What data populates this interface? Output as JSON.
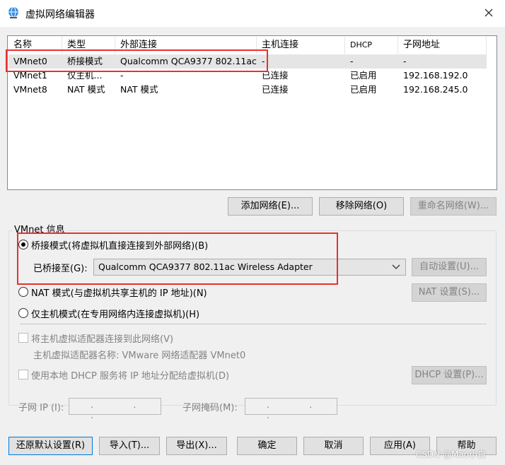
{
  "window": {
    "title": "虚拟网络编辑器",
    "icon": "globe-network-icon",
    "close": "close-icon"
  },
  "table": {
    "headers": [
      "名称",
      "类型",
      "外部连接",
      "主机连接",
      "DHCP",
      "子网地址"
    ],
    "rows": [
      {
        "name": "VMnet0",
        "type": "桥接模式",
        "external": "Qualcomm QCA9377 802.11ac...",
        "host": "-",
        "dhcp": "-",
        "subnet": "-"
      },
      {
        "name": "VMnet1",
        "type": "仅主机...",
        "external": "-",
        "host": "已连接",
        "dhcp": "已启用",
        "subnet": "192.168.192.0"
      },
      {
        "name": "VMnet8",
        "type": "NAT 模式",
        "external": "NAT 模式",
        "host": "已连接",
        "dhcp": "已启用",
        "subnet": "192.168.245.0"
      }
    ]
  },
  "table_buttons": {
    "add": "添加网络(E)...",
    "remove": "移除网络(O)",
    "rename": "重命名网络(W)..."
  },
  "vmnet_info": {
    "legend": "VMnet 信息",
    "bridged_label": "桥接模式(将虚拟机直接连接到外部网络)(B)",
    "bridged_to_label": "已桥接至(G):",
    "bridged_to_value": "Qualcomm QCA9377 802.11ac Wireless Adapter",
    "auto_settings": "自动设置(U)...",
    "nat_label": "NAT 模式(与虚拟机共享主机的 IP 地址)(N)",
    "nat_settings": "NAT 设置(S)...",
    "hostonly_label": "仅主机模式(在专用网络内连接虚拟机)(H)",
    "connect_adapter_label": "将主机虚拟适配器连接到此网络(V)",
    "adapter_name_label": "主机虚拟适配器名称: VMware 网络适配器 VMnet0",
    "dhcp_label": "使用本地 DHCP 服务将 IP 地址分配给虚拟机(D)",
    "dhcp_settings": "DHCP 设置(P)...",
    "subnet_ip_label": "子网 IP (I):",
    "subnet_mask_label": "子网掩码(M):",
    "ip_placeholder": ".   .   ."
  },
  "bottom_buttons": {
    "restore": "还原默认设置(R)",
    "import": "导入(T)...",
    "export": "导出(X)...",
    "ok": "确定",
    "cancel": "取消",
    "apply": "应用(A)",
    "help": "帮助"
  },
  "watermark": "CSDN @Mao小白",
  "colors": {
    "highlight": "#e8312f",
    "selected_row": "#e5e5e5"
  }
}
